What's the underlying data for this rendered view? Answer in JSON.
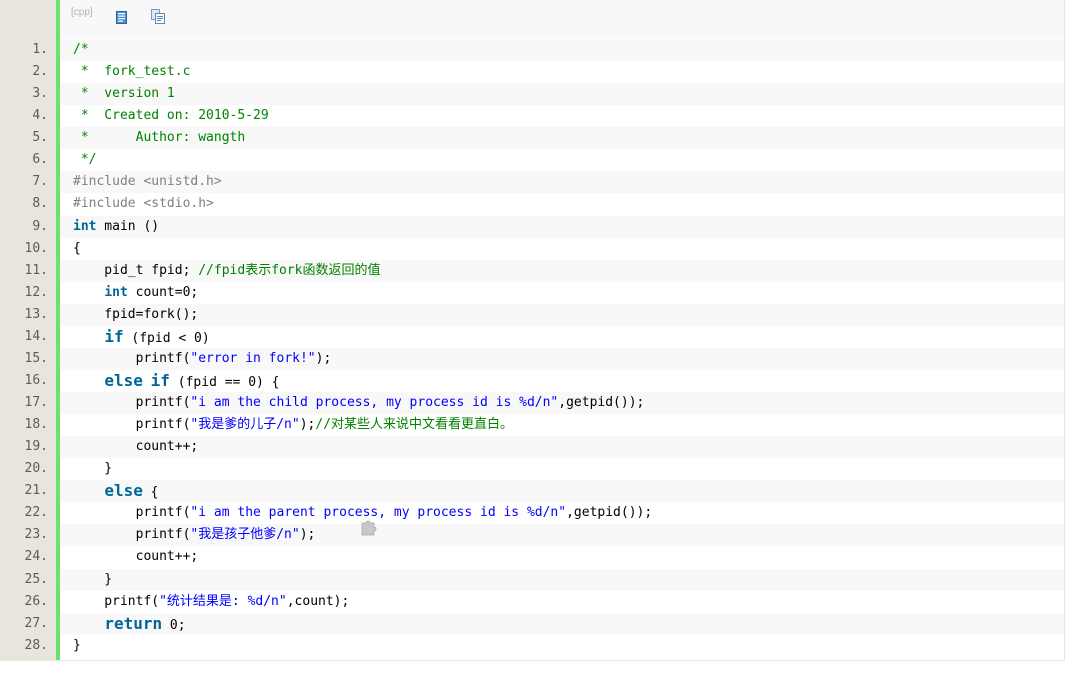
{
  "toolbar": {
    "lang": "[cpp]",
    "view_plain_icon": "view-plain-icon",
    "copy_icon": "copy-to-clipboard-icon"
  },
  "colors": {
    "gutter": "#e7e5dc",
    "accent_bar": "#6ce26c",
    "comment": "#008200",
    "keyword": "#006699",
    "string": "#0000ff",
    "preprocessor": "#808080"
  },
  "lines": [
    {
      "n": "1.",
      "tokens": [
        {
          "t": "/*",
          "c": "comment"
        }
      ]
    },
    {
      "n": "2.",
      "tokens": [
        {
          "t": " *  fork_test.c",
          "c": "comment"
        }
      ]
    },
    {
      "n": "3.",
      "tokens": [
        {
          "t": " *  version 1",
          "c": "comment"
        }
      ]
    },
    {
      "n": "4.",
      "tokens": [
        {
          "t": " *  Created on: 2010-5-29",
          "c": "comment"
        }
      ]
    },
    {
      "n": "5.",
      "tokens": [
        {
          "t": " *      Author: wangth",
          "c": "comment"
        }
      ]
    },
    {
      "n": "6.",
      "tokens": [
        {
          "t": " */",
          "c": "comment"
        }
      ]
    },
    {
      "n": "7.",
      "tokens": [
        {
          "t": "#include <unistd.h>",
          "c": "pre"
        }
      ]
    },
    {
      "n": "8.",
      "tokens": [
        {
          "t": "#include <stdio.h>",
          "c": "pre"
        }
      ]
    },
    {
      "n": "9.",
      "tokens": [
        {
          "t": "int",
          "c": "typekw"
        },
        {
          "t": " main ()",
          "c": "plain"
        }
      ]
    },
    {
      "n": "10.",
      "tokens": [
        {
          "t": "{",
          "c": "plain"
        }
      ]
    },
    {
      "n": "11.",
      "tokens": [
        {
          "t": "    pid_t fpid; ",
          "c": "plain"
        },
        {
          "t": "//fpid表示fork函数返回的值",
          "c": "comment"
        }
      ]
    },
    {
      "n": "12.",
      "tokens": [
        {
          "t": "    ",
          "c": "plain"
        },
        {
          "t": "int",
          "c": "typekw"
        },
        {
          "t": " count=0;",
          "c": "plain"
        }
      ]
    },
    {
      "n": "13.",
      "tokens": [
        {
          "t": "    fpid=fork();",
          "c": "plain"
        }
      ]
    },
    {
      "n": "14.",
      "tokens": [
        {
          "t": "    ",
          "c": "plain"
        },
        {
          "t": "if",
          "c": "kwbig"
        },
        {
          "t": " (fpid < 0)",
          "c": "plain"
        }
      ]
    },
    {
      "n": "15.",
      "tokens": [
        {
          "t": "        printf(",
          "c": "plain"
        },
        {
          "t": "\"error in fork!\"",
          "c": "str"
        },
        {
          "t": ");",
          "c": "plain"
        }
      ]
    },
    {
      "n": "16.",
      "tokens": [
        {
          "t": "    ",
          "c": "plain"
        },
        {
          "t": "else",
          "c": "kwbig"
        },
        {
          "t": " ",
          "c": "plain"
        },
        {
          "t": "if",
          "c": "kwbig"
        },
        {
          "t": " (fpid == 0) {",
          "c": "plain"
        }
      ]
    },
    {
      "n": "17.",
      "tokens": [
        {
          "t": "        printf(",
          "c": "plain"
        },
        {
          "t": "\"i am the child process, my process id is %d/n\"",
          "c": "str"
        },
        {
          "t": ",getpid());",
          "c": "plain"
        }
      ]
    },
    {
      "n": "18.",
      "tokens": [
        {
          "t": "        printf(",
          "c": "plain"
        },
        {
          "t": "\"我是爹的儿子/n\"",
          "c": "str"
        },
        {
          "t": ");",
          "c": "plain"
        },
        {
          "t": "//对某些人来说中文看看更直白。",
          "c": "comment"
        }
      ]
    },
    {
      "n": "19.",
      "tokens": [
        {
          "t": "        count++;",
          "c": "plain"
        }
      ]
    },
    {
      "n": "20.",
      "tokens": [
        {
          "t": "    }",
          "c": "plain"
        }
      ]
    },
    {
      "n": "21.",
      "tokens": [
        {
          "t": "    ",
          "c": "plain"
        },
        {
          "t": "else",
          "c": "kwbig"
        },
        {
          "t": " {",
          "c": "plain"
        }
      ]
    },
    {
      "n": "22.",
      "tokens": [
        {
          "t": "        printf(",
          "c": "plain"
        },
        {
          "t": "\"i am the parent process, my process id is %d/n\"",
          "c": "str"
        },
        {
          "t": ",getpid());",
          "c": "plain"
        }
      ]
    },
    {
      "n": "23.",
      "tokens": [
        {
          "t": "        printf(",
          "c": "plain"
        },
        {
          "t": "\"我是孩子他爹/n\"",
          "c": "str"
        },
        {
          "t": ");",
          "c": "plain"
        }
      ]
    },
    {
      "n": "24.",
      "tokens": [
        {
          "t": "        count++;",
          "c": "plain"
        }
      ]
    },
    {
      "n": "25.",
      "tokens": [
        {
          "t": "    }",
          "c": "plain"
        }
      ]
    },
    {
      "n": "26.",
      "tokens": [
        {
          "t": "    printf(",
          "c": "plain"
        },
        {
          "t": "\"统计结果是: %d/n\"",
          "c": "str"
        },
        {
          "t": ",count);",
          "c": "plain"
        }
      ]
    },
    {
      "n": "27.",
      "tokens": [
        {
          "t": "    ",
          "c": "plain"
        },
        {
          "t": "return",
          "c": "kwbig"
        },
        {
          "t": " 0;",
          "c": "plain"
        }
      ]
    },
    {
      "n": "28.",
      "tokens": [
        {
          "t": "}",
          "c": "plain"
        }
      ]
    }
  ]
}
